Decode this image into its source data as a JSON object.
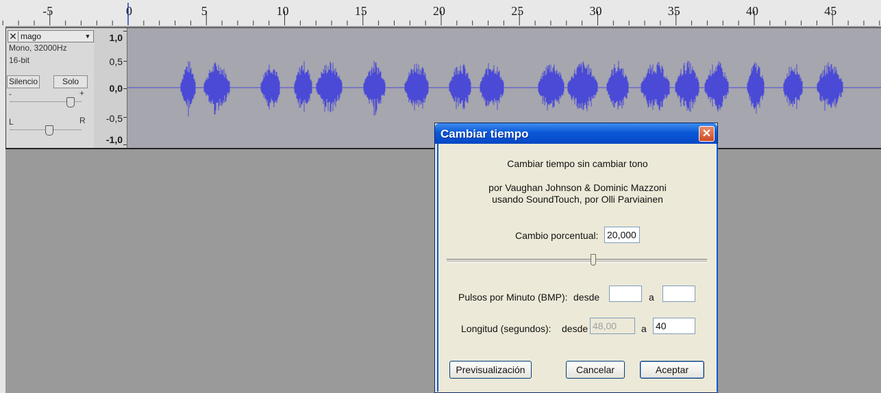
{
  "ruler": {
    "ticks": [
      "-5",
      "0",
      "5",
      "10",
      "15",
      "20",
      "25",
      "30",
      "35",
      "40",
      "45"
    ]
  },
  "track": {
    "close_symbol": "✕",
    "name": "mago",
    "info_line1": "Mono, 32000Hz",
    "info_line2": "16-bit",
    "mute_label": "Silencio",
    "solo_label": "Solo",
    "gain_minus": "-",
    "gain_plus": "+",
    "pan_left": "L",
    "pan_right": "R",
    "amplitude_labels": [
      "1,0",
      "0,5",
      "0,0",
      "-0,5",
      "-1,0"
    ]
  },
  "dialog": {
    "title": "Cambiar tiempo",
    "close_symbol": "✕",
    "description": "Cambiar tiempo sin cambiar tono",
    "credits_line1": "por Vaughan Johnson & Dominic Mazzoni",
    "credits_line2": "usando SoundTouch, por Olli Parviainen",
    "percent_label": "Cambio porcentual:",
    "percent_value": "20,000",
    "percent_slider_fraction": 0.56,
    "bpm_label": "Pulsos por Minuto (BMP):",
    "bpm_from_label": "desde",
    "bpm_from_value": "",
    "bpm_to_label": "a",
    "bpm_to_value": "",
    "length_label": "Longitud (segundos):",
    "length_from_label": "desde",
    "length_from_value": "48,00",
    "length_to_label": "a",
    "length_to_value": "40",
    "preview_button": "Previsualización",
    "cancel_button": "Cancelar",
    "ok_button": "Aceptar"
  },
  "colors": {
    "waveform": "#4a4ad6",
    "title_bar": "#0a58d6",
    "close_button": "#d8573a"
  }
}
